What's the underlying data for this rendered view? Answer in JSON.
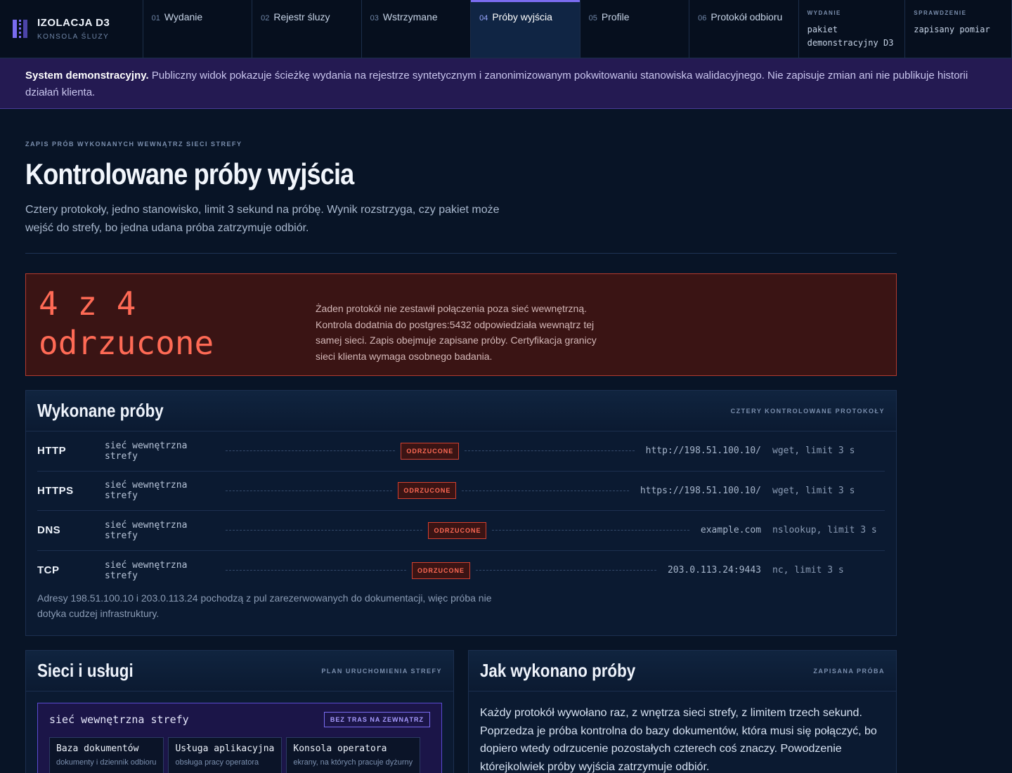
{
  "brand": {
    "title": "IZOLACJA D3",
    "subtitle": "KONSOLA ŚLUZY"
  },
  "tabs": [
    {
      "num": "01",
      "label": "Wydanie"
    },
    {
      "num": "02",
      "label": "Rejestr śluzy"
    },
    {
      "num": "03",
      "label": "Wstrzymane"
    },
    {
      "num": "04",
      "label": "Próby wyjścia"
    },
    {
      "num": "05",
      "label": "Profile"
    },
    {
      "num": "06",
      "label": "Protokół odbioru"
    }
  ],
  "meta": [
    {
      "label": "WYDANIE",
      "value": "pakiet demonstracyjny D3"
    },
    {
      "label": "SPRAWDZENIE",
      "value": "zapisany pomiar"
    }
  ],
  "banner": {
    "strong": "System demonstracyjny.",
    "text": "Publiczny widok pokazuje ścieżkę wydania na rejestrze syntetycznym i zanonimizowanym pokwitowaniu stanowiska walidacyjnego. Nie zapisuje zmian ani nie publikuje historii działań klienta."
  },
  "page": {
    "eyebrow": "ZAPIS PRÓB WYKONANYCH WEWNĄTRZ SIECI STREFY",
    "title": "Kontrolowane próby wyjścia",
    "lead": "Cztery protokoły, jedno stanowisko, limit 3 sekund na próbę. Wynik rozstrzyga, czy pakiet może wejść do strefy, bo jedna udana próba zatrzymuje odbiór."
  },
  "verdict": {
    "headline": "4 z 4 odrzucone",
    "text": "Żaden protokół nie zestawił połączenia poza sieć wewnętrzną. Kontrola dodatnia do postgres:5432 odpowiedziała wewnątrz tej samej sieci. Zapis obejmuje zapisane próby. Certyfikacja granicy sieci klienta wymaga osobnego badania."
  },
  "attempts": {
    "title": "Wykonane próby",
    "tag": "CZTERY KONTROLOWANE PROTOKOŁY",
    "rows": [
      {
        "proto": "HTTP",
        "source": "sieć wewnętrzna strefy",
        "status": "ODRZUCONE",
        "target": "http://198.51.100.10/",
        "tool": "wget, limit 3 s"
      },
      {
        "proto": "HTTPS",
        "source": "sieć wewnętrzna strefy",
        "status": "ODRZUCONE",
        "target": "https://198.51.100.10/",
        "tool": "wget, limit 3 s"
      },
      {
        "proto": "DNS",
        "source": "sieć wewnętrzna strefy",
        "status": "ODRZUCONE",
        "target": "example.com",
        "tool": "nslookup, limit 3 s"
      },
      {
        "proto": "TCP",
        "source": "sieć wewnętrzna strefy",
        "status": "ODRZUCONE",
        "target": "203.0.113.24:9443",
        "tool": "nc, limit 3 s"
      }
    ],
    "note": "Adresy 198.51.100.10 i 203.0.113.24 pochodzą z pul zarezerwowanych do dokumentacji, więc próba nie dotyka cudzej infrastruktury."
  },
  "networks": {
    "title": "Sieci i usługi",
    "tag": "PLAN URUCHOMIENIA STREFY",
    "net_name": "sieć wewnętrzna strefy",
    "net_badge": "BEZ TRAS NA ZEWNĄTRZ",
    "services": [
      {
        "name": "Baza dokumentów",
        "desc": "dokumenty i dziennik odbioru"
      },
      {
        "name": "Usługa aplikacyjna",
        "desc": "obsługa pracy operatora"
      },
      {
        "name": "Konsola operatora",
        "desc": "ekrany, na których pracuje dyżurny"
      }
    ]
  },
  "how": {
    "title": "Jak wykonano próby",
    "tag": "ZAPISANA PRÓBA",
    "text": "Każdy protokół wywołano raz, z wnętrza sieci strefy, z limitem trzech sekund. Poprzedza je próba kontrolna do bazy dokumentów, która musi się połączyć, bo dopiero wtedy odrzucenie pozostałych czterech coś znaczy. Powodzenie którejkolwiek próby wyjścia zatrzymuje odbiór."
  }
}
